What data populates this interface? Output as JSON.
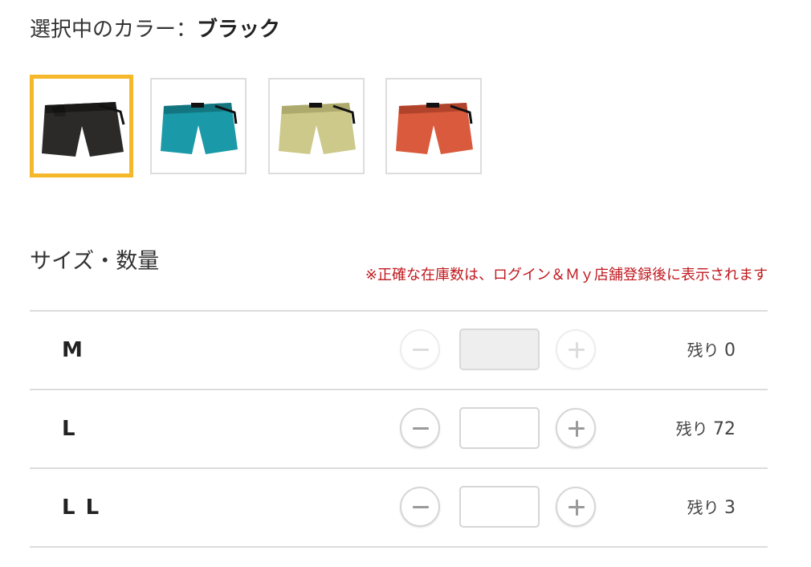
{
  "color_selector": {
    "prefix": "選択中のカラー：",
    "selected_color": "ブラック",
    "swatches": [
      {
        "name": "ブラック",
        "color": "#2b2a28",
        "shade": "#1a1918",
        "active": true
      },
      {
        "name": "ターコイズ",
        "color": "#1a9aa8",
        "shade": "#127580",
        "active": false
      },
      {
        "name": "ライトイエロー",
        "color": "#ccc98a",
        "shade": "#aeaa6e",
        "active": false
      },
      {
        "name": "オレンジ",
        "color": "#d95a3c",
        "shade": "#b0432a",
        "active": false
      }
    ],
    "active_border_color": "#f5b82a"
  },
  "size_section": {
    "title": "サイズ・数量",
    "stock_note": "※正確な在庫数は、ログイン＆Ｍｙ店舗登録後に表示されます",
    "stock_prefix": "残り",
    "rows": [
      {
        "size": "M",
        "quantity": "",
        "stock": "0",
        "disabled": true
      },
      {
        "size": "L",
        "quantity": "",
        "stock": "72",
        "disabled": false
      },
      {
        "size": "L L",
        "quantity": "",
        "stock": "3",
        "disabled": false
      }
    ]
  },
  "colors": {
    "note_red": "#c0191f",
    "divider": "#dcdcdc"
  },
  "icons": {
    "decrease": "minus-icon",
    "increase": "plus-icon"
  }
}
